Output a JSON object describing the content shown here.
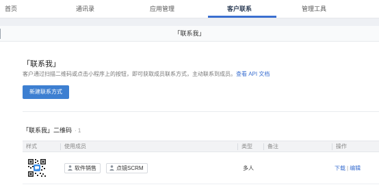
{
  "nav": {
    "tabs": [
      {
        "label": "首页"
      },
      {
        "label": "通讯录"
      },
      {
        "label": "应用管理"
      },
      {
        "label": "客户联系"
      },
      {
        "label": "管理工具"
      }
    ],
    "active_index": 3
  },
  "page": {
    "header_title": "「联系我」"
  },
  "intro": {
    "title": "「联系我」",
    "description": "客户通过扫描二维码或点击小程序上的按钮，即可获取成员联系方式，主动联系到成员。",
    "doc_link": "查看 API 文档",
    "create_button": "新建联系方式"
  },
  "list": {
    "title": "「联系我」二维码",
    "count": "· 1",
    "columns": [
      "样式",
      "使用成员",
      "类型",
      "备注",
      "操作"
    ],
    "rows": [
      {
        "members": [
          "软件销售",
          "点镜SCRM"
        ],
        "type": "多人",
        "note": "",
        "actions": [
          "下载",
          "编辑"
        ]
      }
    ]
  },
  "colors": {
    "accent": "#3a6fd0",
    "button": "#3d7fd1"
  },
  "icons": [
    "person-icon",
    "qr-code-icon"
  ]
}
